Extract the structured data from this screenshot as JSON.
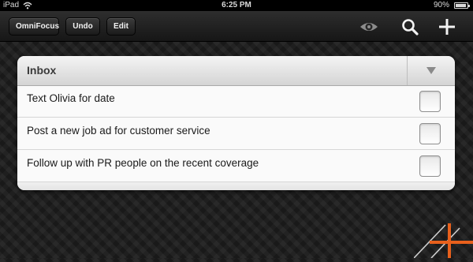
{
  "status_bar": {
    "carrier": "iPad",
    "time": "6:25 PM",
    "battery": "90%",
    "wifi_icon": "wifi-icon",
    "battery_icon": "battery-icon"
  },
  "toolbar": {
    "app_label": "OmniFocus",
    "undo_label": "Undo",
    "edit_label": "Edit",
    "icons": [
      "eye-icon",
      "search-icon",
      "plus-icon"
    ]
  },
  "inbox": {
    "title": "Inbox",
    "toggle_icon": "triangle-down-icon",
    "items": [
      {
        "text": "Text Olivia for date",
        "checked": false
      },
      {
        "text": "Post a new job ad for customer service",
        "checked": false
      },
      {
        "text": "Follow up with PR people on the recent coverage",
        "checked": false
      }
    ]
  },
  "colors": {
    "accent_orange": "#e8601c",
    "background": "#1c1c1c"
  }
}
